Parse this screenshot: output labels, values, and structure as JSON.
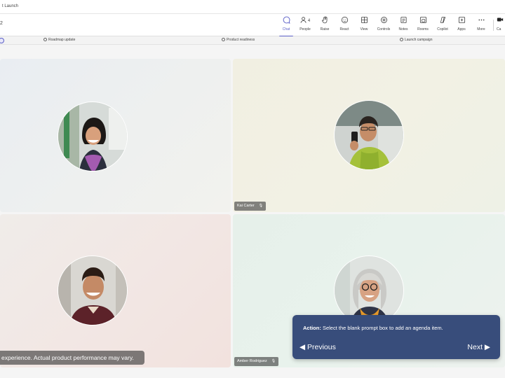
{
  "window": {
    "title": "t Launch"
  },
  "toolbar": {
    "meeting_time": "2",
    "items": [
      {
        "label": "Chat",
        "icon": "chat-icon"
      },
      {
        "label": "People",
        "icon": "people-icon",
        "count": "4"
      },
      {
        "label": "Raise",
        "icon": "raise-hand-icon"
      },
      {
        "label": "React",
        "icon": "react-icon"
      },
      {
        "label": "View",
        "icon": "view-icon"
      },
      {
        "label": "Controls",
        "icon": "controls-icon"
      },
      {
        "label": "Notes",
        "icon": "notes-icon"
      },
      {
        "label": "Rooms",
        "icon": "rooms-icon"
      },
      {
        "label": "Copilot",
        "icon": "copilot-icon"
      },
      {
        "label": "Apps",
        "icon": "apps-icon"
      },
      {
        "label": "More",
        "icon": "more-icon"
      }
    ],
    "camera_label": "Ca"
  },
  "agenda": {
    "items": [
      {
        "label": "Roadmap update"
      },
      {
        "label": "Product readiness"
      },
      {
        "label": "Launch campaign"
      }
    ]
  },
  "participants": [
    {
      "name": ""
    },
    {
      "name": "Kai Carter"
    },
    {
      "name": ""
    },
    {
      "name": "Amber Rodriguez"
    }
  ],
  "disclaimer": "experience. Actual product performance may vary.",
  "coach": {
    "action_label": "Action:",
    "action_text": "Select the blank prompt box to add an agenda item.",
    "previous_label": "Previous",
    "next_label": "Next"
  },
  "colors": {
    "accent": "#5b5fc7",
    "coach_bg": "#384d7b"
  }
}
